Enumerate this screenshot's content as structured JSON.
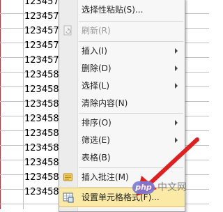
{
  "sheet": {
    "cells": [
      "123457",
      "123457",
      "123457",
      "123457",
      "123457",
      "123458",
      "123458",
      "123458",
      "123458",
      "123458",
      "123458",
      "123458",
      "123458",
      "123458"
    ]
  },
  "menu": {
    "items": [
      {
        "label": "选择性粘贴(S)...",
        "disabled": false,
        "submenu": false,
        "icon": ""
      },
      {
        "label": "刷新(R)",
        "disabled": true,
        "submenu": false,
        "icon": "refresh-icon"
      },
      {
        "label": "插入(I)",
        "disabled": false,
        "submenu": true,
        "icon": ""
      },
      {
        "label": "删除(D)",
        "disabled": false,
        "submenu": true,
        "icon": ""
      },
      {
        "label": "选择(L)",
        "disabled": false,
        "submenu": true,
        "icon": ""
      },
      {
        "label": "清除内容(N)",
        "disabled": false,
        "submenu": false,
        "icon": ""
      },
      {
        "label": "排序(O)",
        "disabled": false,
        "submenu": true,
        "icon": ""
      },
      {
        "label": "筛选(E)",
        "disabled": false,
        "submenu": true,
        "icon": ""
      },
      {
        "label": "表格(B)",
        "disabled": false,
        "submenu": false,
        "icon": ""
      },
      {
        "label": "插入批注(M)",
        "disabled": false,
        "submenu": false,
        "icon": "comment-icon"
      },
      {
        "label": "设置单元格格式(F)...",
        "disabled": false,
        "submenu": false,
        "icon": "format-cells-icon",
        "highlighted": true
      }
    ]
  },
  "watermark": {
    "logo": "php",
    "text": "中文网"
  },
  "colors": {
    "arrow": "#e02020",
    "highlight": "#fbe9a6",
    "menu_bg": "#f7f7f7"
  }
}
